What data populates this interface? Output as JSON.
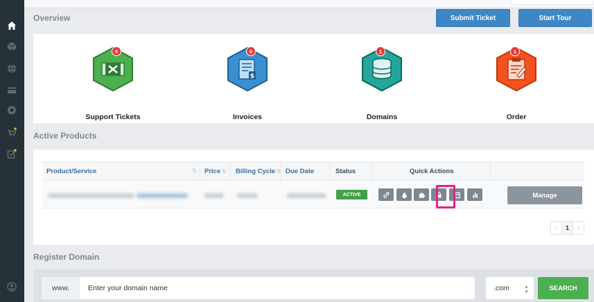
{
  "sidebar": {
    "icons": [
      "home-icon",
      "cube-icon",
      "globe-icon",
      "credit-card-icon",
      "life-ring-icon",
      "cart-star-icon",
      "edit-star-icon",
      "user-circle-icon"
    ]
  },
  "overview": {
    "title": "Overview",
    "submit_ticket": "Submit Ticket",
    "start_tour": "Start Tour",
    "items": [
      {
        "label": "Support Tickets",
        "count": "0",
        "icon": "tools-ticket-icon",
        "color": "#4caf50"
      },
      {
        "label": "Invoices",
        "count": "0",
        "icon": "invoice-icon",
        "color": "#3a8fd0"
      },
      {
        "label": "Domains",
        "count": "1",
        "icon": "database-icon",
        "color": "#26a69a"
      },
      {
        "label": "Order",
        "count": "1",
        "icon": "clipboard-order-icon",
        "color": "#f4511e"
      }
    ]
  },
  "products": {
    "title": "Active Products",
    "columns": [
      "Product/Service",
      "Price",
      "Billing Cycle",
      "Due Date",
      "Status",
      "Quick Actions"
    ],
    "row": {
      "status": "ACTIVE",
      "quick_actions": [
        "link-icon",
        "drop-icon",
        "puzzle-icon",
        "lock-icon",
        "calendar-icon",
        "bar-chart-icon"
      ],
      "manage": "Manage"
    },
    "pager": {
      "prev": "‹",
      "current": "1",
      "next": "›"
    }
  },
  "register": {
    "title": "Register Domain",
    "prefix": "www.",
    "placeholder": "Enter your domain name",
    "tld": ".com",
    "search": "SEARCH"
  }
}
